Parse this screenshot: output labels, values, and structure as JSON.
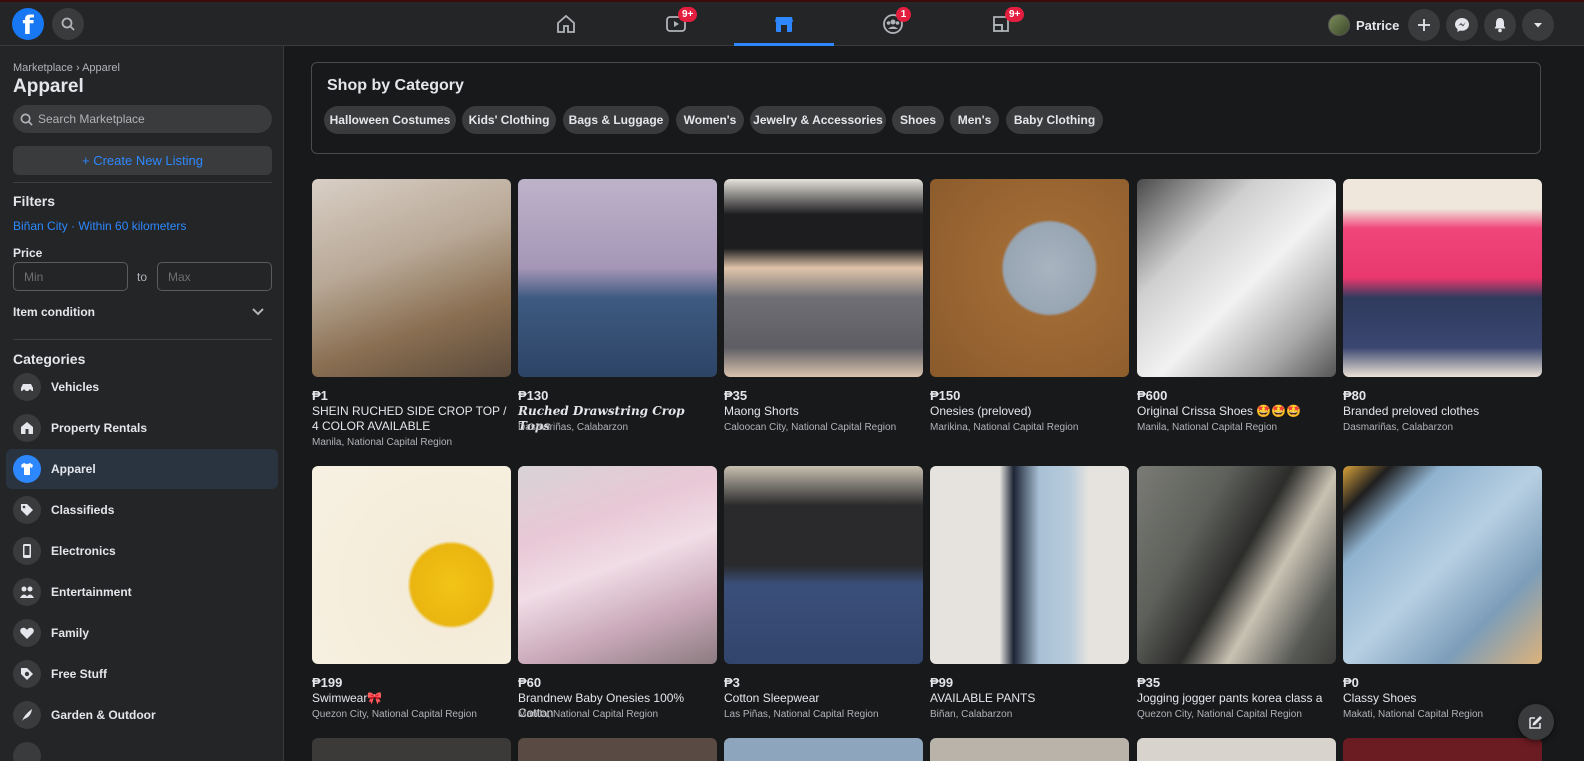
{
  "topbar": {
    "logo_letter": "f",
    "badges": {
      "watch": "9+",
      "groups": "1",
      "gaming": "9+"
    },
    "profile_name": "Patrice"
  },
  "sidebar": {
    "breadcrumb": "Marketplace › Apparel",
    "title": "Apparel",
    "search_placeholder": "Search Marketplace",
    "create_label": "+ Create New Listing",
    "filters_heading": "Filters",
    "location": "Biñan City · Within 60 kilometers",
    "price_heading": "Price",
    "min_placeholder": "Min",
    "max_placeholder": "Max",
    "price_to": "to",
    "item_condition": "Item condition",
    "categories_heading": "Categories",
    "categories": [
      {
        "label": "Vehicles",
        "icon": "car-icon"
      },
      {
        "label": "Property Rentals",
        "icon": "house-icon"
      },
      {
        "label": "Apparel",
        "icon": "shirt-icon",
        "active": true
      },
      {
        "label": "Classifieds",
        "icon": "tag-icon"
      },
      {
        "label": "Electronics",
        "icon": "phone-icon"
      },
      {
        "label": "Entertainment",
        "icon": "people-icon"
      },
      {
        "label": "Family",
        "icon": "heart-icon"
      },
      {
        "label": "Free Stuff",
        "icon": "free-tag-icon"
      },
      {
        "label": "Garden & Outdoor",
        "icon": "plant-icon"
      }
    ]
  },
  "shop": {
    "title": "Shop by Category",
    "chips": [
      "Halloween Costumes",
      "Kids' Clothing",
      "Bags & Luggage",
      "Women's",
      "Jewelry & Accessories",
      "Shoes",
      "Men's",
      "Baby Clothing"
    ]
  },
  "listings": [
    {
      "price": "₱1",
      "title": "SHEIN RUCHED SIDE CROP TOP / 4 COLOR AVAILABLE",
      "location": "Manila, National Capital Region"
    },
    {
      "price": "₱130",
      "title": "𝑹𝒖𝒄𝒉𝒆𝒅 𝑫𝒓𝒂𝒘𝒔𝒕𝒓𝒊𝒏𝒈 𝑪𝒓𝒐𝒑 𝑻𝒐𝒑𝒔",
      "location": "Dasmariñas, Calabarzon"
    },
    {
      "price": "₱35",
      "title": "Maong Shorts",
      "location": "Caloocan City, National Capital Region"
    },
    {
      "price": "₱150",
      "title": "Onesies (preloved)",
      "location": "Marikina, National Capital Region"
    },
    {
      "price": "₱600",
      "title": "Original Crissa Shoes 🤩🤩🤩",
      "location": "Manila, National Capital Region"
    },
    {
      "price": "₱80",
      "title": "Branded preloved clothes",
      "location": "Dasmariñas, Calabarzon"
    },
    {
      "price": "₱199",
      "title": "Swimwear🎀",
      "location": "Quezon City, National Capital Region"
    },
    {
      "price": "₱60",
      "title": "Brandnew Baby Onesies 100% Cotton",
      "location": "Manila, National Capital Region"
    },
    {
      "price": "₱3",
      "title": "Cotton Sleepwear",
      "location": "Las Piñas, National Capital Region"
    },
    {
      "price": "₱99",
      "title": "AVAILABLE PANTS",
      "location": "Biñan, Calabarzon"
    },
    {
      "price": "₱35",
      "title": "Jogging jogger pants korea class a",
      "location": "Quezon City, National Capital Region"
    },
    {
      "price": "₱0",
      "title": "Classy Shoes",
      "location": "Makati, National Capital Region"
    }
  ],
  "colors": {
    "accent": "#2d88ff",
    "badge": "#e41e3f",
    "surface": "#242526",
    "background": "#18191a"
  }
}
